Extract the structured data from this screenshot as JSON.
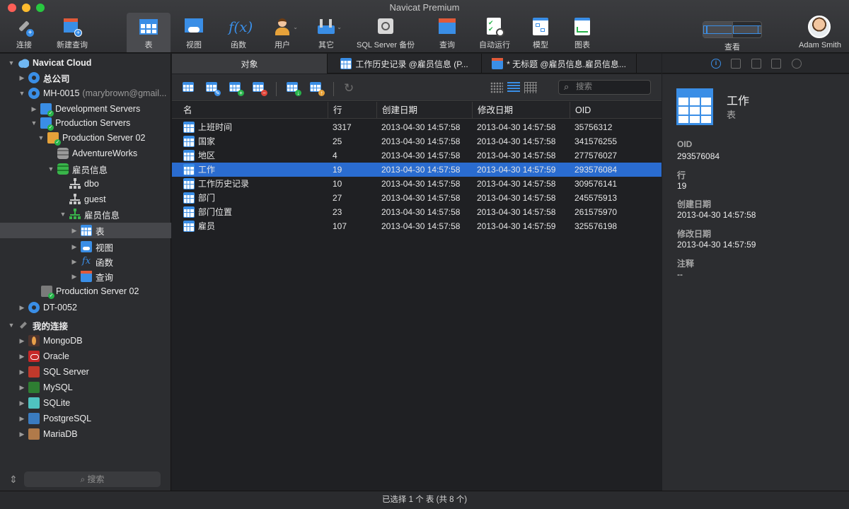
{
  "window": {
    "title": "Navicat Premium"
  },
  "toolbar": {
    "items": [
      {
        "label": "连接",
        "icon": "connect-icon"
      },
      {
        "label": "新建查询",
        "icon": "new-query-icon"
      },
      {
        "label": "表",
        "icon": "table-icon",
        "active": true
      },
      {
        "label": "视图",
        "icon": "view-icon"
      },
      {
        "label": "函数",
        "icon": "function-icon"
      },
      {
        "label": "用户",
        "icon": "user-icon"
      },
      {
        "label": "其它",
        "icon": "others-icon"
      },
      {
        "label": "SQL Server 备份",
        "icon": "backup-icon"
      },
      {
        "label": "查询",
        "icon": "query-icon"
      },
      {
        "label": "自动运行",
        "icon": "automation-icon"
      },
      {
        "label": "模型",
        "icon": "model-icon"
      },
      {
        "label": "图表",
        "icon": "chart-icon"
      }
    ],
    "view_label": "查看",
    "user_name": "Adam Smith"
  },
  "sidebar": {
    "tree": [
      {
        "label": "Navicat Cloud",
        "icon": "cloud-icon",
        "bold": true
      },
      {
        "label": "总公司",
        "icon": "gear-icon"
      },
      {
        "label": "MH-0015",
        "extra": "(marybrown@gmail...",
        "icon": "gear-icon"
      },
      {
        "label": "Development Servers",
        "icon": "folder-icon"
      },
      {
        "label": "Production Servers",
        "icon": "folder-icon"
      },
      {
        "label": "Production Server 02",
        "icon": "server-icon"
      },
      {
        "label": "AdventureWorks",
        "icon": "database-icon"
      },
      {
        "label": "雇员信息",
        "icon": "database-icon"
      },
      {
        "label": "dbo",
        "icon": "schema-icon"
      },
      {
        "label": "guest",
        "icon": "schema-icon"
      },
      {
        "label": "雇员信息",
        "icon": "schema-icon"
      },
      {
        "label": "表",
        "icon": "table-icon"
      },
      {
        "label": "视图",
        "icon": "view-icon"
      },
      {
        "label": "函数",
        "icon": "function-icon"
      },
      {
        "label": "查询",
        "icon": "query-icon"
      },
      {
        "label": "Production Server 02",
        "icon": "server-icon"
      },
      {
        "label": "DT-0052",
        "icon": "gear-icon"
      },
      {
        "label": "我的连接",
        "icon": "plug-icon",
        "bold": true
      },
      {
        "label": "MongoDB",
        "icon": "mongodb-icon"
      },
      {
        "label": "Oracle",
        "icon": "oracle-icon"
      },
      {
        "label": "SQL Server",
        "icon": "sqlserver-icon"
      },
      {
        "label": "MySQL",
        "icon": "mysql-icon"
      },
      {
        "label": "SQLite",
        "icon": "sqlite-icon"
      },
      {
        "label": "PostgreSQL",
        "icon": "postgresql-icon"
      },
      {
        "label": "MariaDB",
        "icon": "mariadb-icon"
      }
    ],
    "search_placeholder": "搜索"
  },
  "tabs": [
    {
      "label": "对象",
      "active": true
    },
    {
      "label": "工作历史记录 @雇员信息 (P..."
    },
    {
      "label": "* 无标题 @雇员信息.雇员信息..."
    }
  ],
  "object_toolbar": {
    "search_placeholder": "搜索"
  },
  "grid": {
    "columns": [
      "名",
      "行",
      "创建日期",
      "修改日期",
      "OID"
    ],
    "rows": [
      [
        "上班时间",
        "3317",
        "2013-04-30 14:57:58",
        "2013-04-30 14:57:58",
        "35756312"
      ],
      [
        "国家",
        "25",
        "2013-04-30 14:57:58",
        "2013-04-30 14:57:58",
        "341576255"
      ],
      [
        "地区",
        "4",
        "2013-04-30 14:57:58",
        "2013-04-30 14:57:58",
        "277576027"
      ],
      [
        "工作",
        "19",
        "2013-04-30 14:57:58",
        "2013-04-30 14:57:59",
        "293576084"
      ],
      [
        "工作历史记录",
        "10",
        "2013-04-30 14:57:58",
        "2013-04-30 14:57:58",
        "309576141"
      ],
      [
        "部门",
        "27",
        "2013-04-30 14:57:58",
        "2013-04-30 14:57:58",
        "245575913"
      ],
      [
        "部门位置",
        "23",
        "2013-04-30 14:57:58",
        "2013-04-30 14:57:58",
        "261575970"
      ],
      [
        "雇员",
        "107",
        "2013-04-30 14:57:58",
        "2013-04-30 14:57:59",
        "325576198"
      ]
    ],
    "selected_row": 3
  },
  "info_panel": {
    "title": "工作",
    "subtitle": "表",
    "fields": [
      {
        "key": "OID",
        "value": "293576084"
      },
      {
        "key": "行",
        "value": "19"
      },
      {
        "key": "创建日期",
        "value": "2013-04-30 14:57:58"
      },
      {
        "key": "修改日期",
        "value": "2013-04-30 14:57:59"
      },
      {
        "key": "注释",
        "value": "--"
      }
    ]
  },
  "status_bar": {
    "text": "已选择 1 个 表 (共 8 个)"
  },
  "colors": {
    "accent": "#3a8ee6",
    "selection": "#2a6cd0",
    "background": "#1e1f22"
  }
}
